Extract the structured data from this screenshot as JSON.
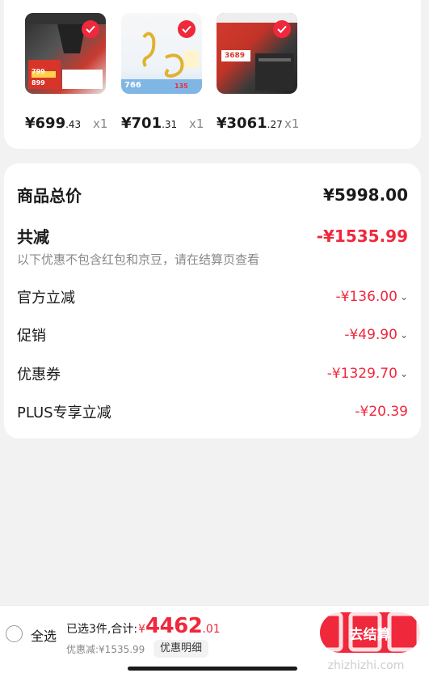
{
  "products": [
    {
      "price_int": "¥699",
      "price_dec": ".43",
      "qty": "x1",
      "thumb_badge": "799",
      "thumb_badge2": "899"
    },
    {
      "price_int": "¥701",
      "price_dec": ".31",
      "qty": "x1",
      "thumb_badge": "766",
      "thumb_badge2": "135"
    },
    {
      "price_int": "¥3061",
      "price_dec": ".27",
      "qty": "x1",
      "thumb_badge": "3689",
      "thumb_badge2": ""
    }
  ],
  "summary": {
    "total_label": "商品总价",
    "total_value": "¥5998.00",
    "reduce_label": "共减",
    "reduce_value": "-¥1535.99",
    "note": "以下优惠不包含红包和京豆，请在结算页查看",
    "items": [
      {
        "label": "官方立减",
        "value": "-¥136.00"
      },
      {
        "label": "促销",
        "value": "-¥49.90"
      },
      {
        "label": "优惠券",
        "value": "-¥1329.70"
      },
      {
        "label": "PLUS专享立减",
        "value": "-¥20.39"
      }
    ]
  },
  "bottom": {
    "select_all": "全选",
    "selected_text": "已选3件,合计:",
    "yen": "¥",
    "amount_int": "4462",
    "amount_dec": ".01",
    "discount_text": "优惠减:¥1535.99",
    "detail_button": "优惠明细",
    "checkout_button": "去结算",
    "watermark": "值 什么值得买",
    "watermark_url": "zhizhizhi.com"
  },
  "colors": {
    "accent": "#f0283c",
    "muted": "#888888",
    "background": "#f2f2f2"
  }
}
